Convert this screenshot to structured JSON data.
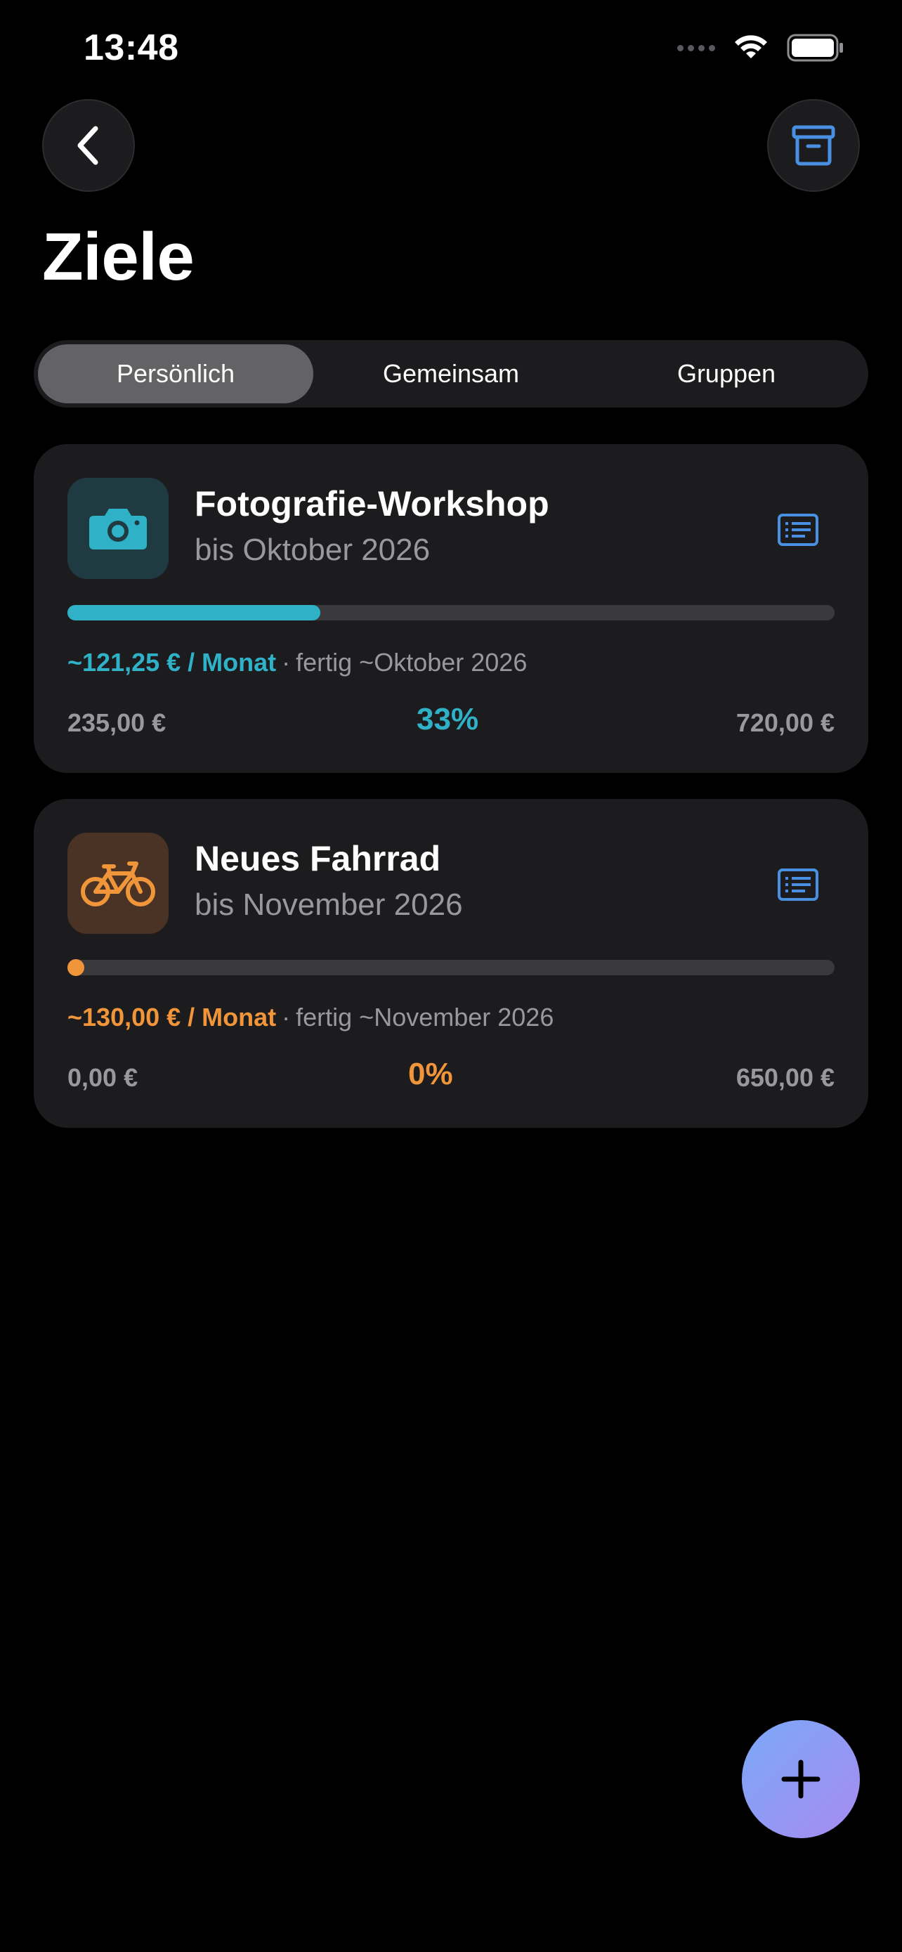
{
  "status_bar": {
    "time": "13:48"
  },
  "header": {
    "title": "Ziele",
    "back_icon": "chevron-left-icon",
    "archive_icon": "archive-box-icon"
  },
  "tabs": [
    {
      "label": "Persönlich",
      "active": true
    },
    {
      "label": "Gemeinsam",
      "active": false
    },
    {
      "label": "Gruppen",
      "active": false
    }
  ],
  "goals": [
    {
      "title": "Fotografie-Workshop",
      "subtitle": "bis Oktober 2026",
      "icon": "camera-icon",
      "accent": "#2fb1c8",
      "icon_bg": "#1f3a40",
      "progress": 0.33,
      "rate": "~121,25 € / Monat",
      "separator": "·",
      "eta": "fertig ~Oktober 2026",
      "saved": "235,00 €",
      "percent": "33%",
      "target": "720,00 €"
    },
    {
      "title": "Neues Fahrrad",
      "subtitle": "bis November 2026",
      "icon": "bicycle-icon",
      "accent": "#f0953a",
      "icon_bg": "#4a3324",
      "progress": 0.0,
      "rate": "~130,00 € / Monat",
      "separator": "·",
      "eta": "fertig ~November 2026",
      "saved": "0,00 €",
      "percent": "0%",
      "target": "650,00 €"
    }
  ],
  "fab": {
    "icon": "plus-icon"
  }
}
